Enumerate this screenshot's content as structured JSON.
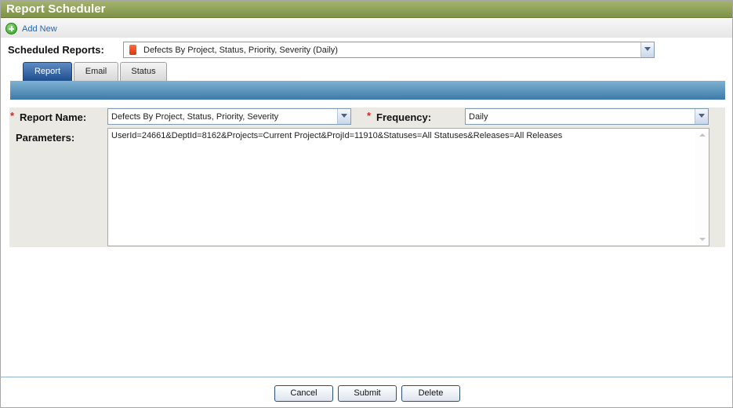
{
  "header": {
    "title": "Report Scheduler"
  },
  "toolbar": {
    "add_label": "Add New",
    "add_icon": "add-circle-icon"
  },
  "scheduled": {
    "label": "Scheduled Reports:",
    "selected": "Defects By Project, Status, Priority, Severity (Daily)",
    "icon": "report-icon"
  },
  "tabs": [
    {
      "label": "Report",
      "active": true
    },
    {
      "label": "Email",
      "active": false
    },
    {
      "label": "Status",
      "active": false
    }
  ],
  "form": {
    "report_name_label": "Report Name:",
    "report_name_value": "Defects By Project, Status, Priority, Severity",
    "frequency_label": "Frequency:",
    "frequency_value": "Daily",
    "required_marker": "*",
    "parameters_label": "Parameters:",
    "parameters_value": "UserId=24661&DeptId=8162&Projects=Current Project&ProjId=11910&Statuses=All Statuses&Releases=All Releases"
  },
  "actions": {
    "cancel": "Cancel",
    "submit": "Submit",
    "delete": "Delete"
  },
  "colors": {
    "title_bar": "#8d9f56",
    "tab_active": "#2c5b9a",
    "blue_bar": "#5a94c0",
    "form_bg": "#eae9e4",
    "link": "#2067b0",
    "required": "#e02020"
  }
}
